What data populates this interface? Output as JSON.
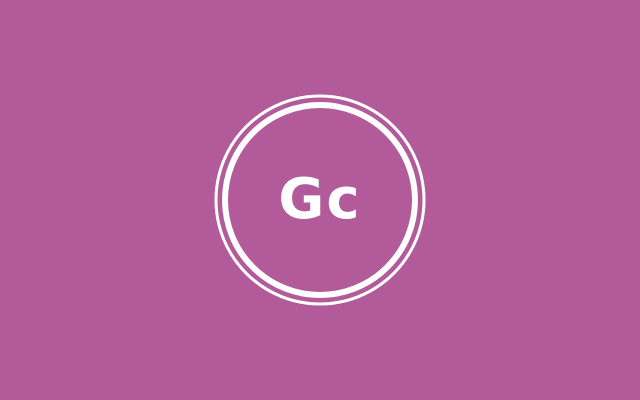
{
  "colors": {
    "background": "#b25a9a",
    "foreground": "#ffffff"
  },
  "logo": {
    "text": "Gc",
    "icon": "circle-badge-icon"
  }
}
